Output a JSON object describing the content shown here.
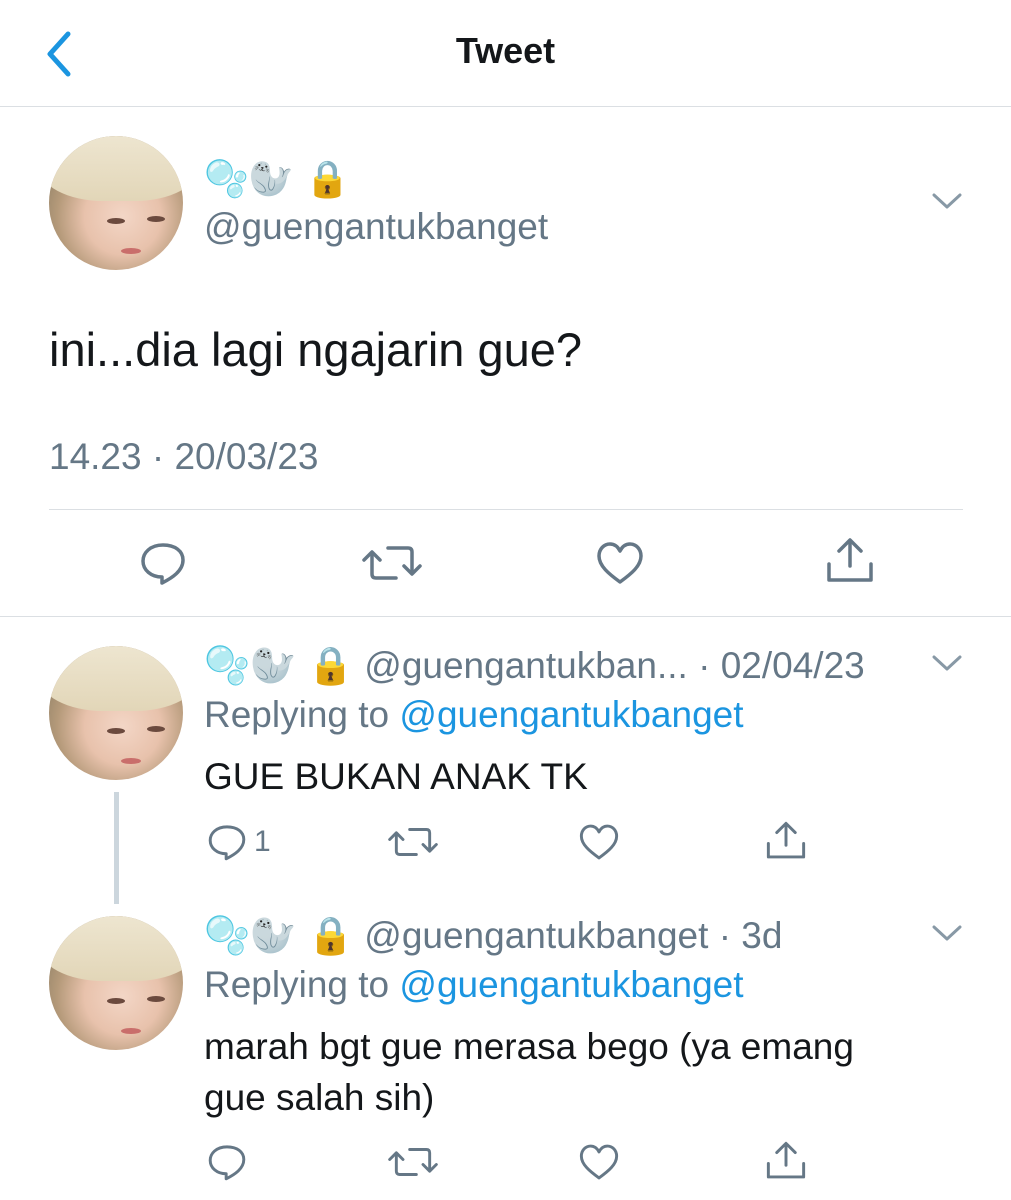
{
  "header": {
    "title": "Tweet"
  },
  "main_tweet": {
    "display_name": "🫧🦭 🔒",
    "handle": "@guengantukbanget",
    "text": "ini...dia lagi ngajarin gue?",
    "timestamp": "14.23 · 20/03/23"
  },
  "replies": [
    {
      "display_name": "🫧🦭 🔒",
      "handle": "@guengantukban...",
      "meta": "· 02/04/23",
      "replying_prefix": "Replying to",
      "replying_to": "@guengantukbanget",
      "text": "GUE BUKAN ANAK TK",
      "reply_count": "1"
    },
    {
      "display_name": "🫧🦭 🔒",
      "handle": "@guengantukbanget",
      "meta": "· 3d",
      "replying_prefix": "Replying to",
      "replying_to": "@guengantukbanget",
      "text_line1": "marah bgt gue merasa bego (ya emang",
      "text_line2": "gue salah sih)"
    }
  ],
  "icons": {
    "back": "chevron-left-icon",
    "more": "chevron-down-icon",
    "reply": "comment-icon",
    "retweet": "retweet-icon",
    "like": "heart-icon",
    "share": "share-icon",
    "lock": "lock-icon"
  },
  "colors": {
    "accent": "#1b95e0",
    "grey": "#657786",
    "divider": "#dbdfe3"
  }
}
